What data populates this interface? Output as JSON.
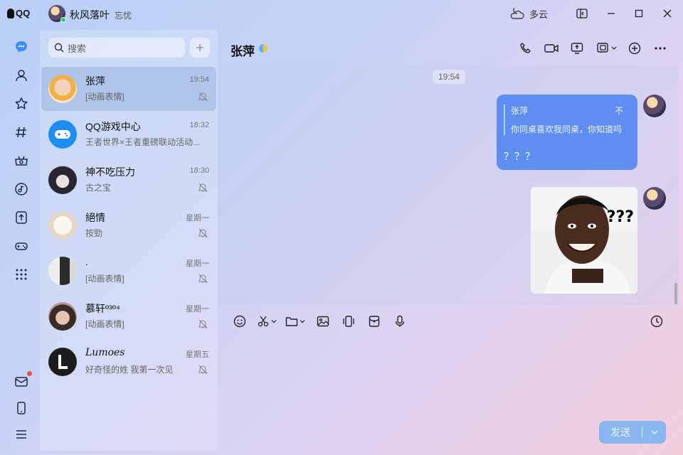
{
  "app": {
    "logo_text": "QQ",
    "accent": "#5f8df0"
  },
  "profile": {
    "name": "秋风落叶",
    "signature": "忘忧"
  },
  "weather": {
    "text": "多云",
    "icon": "cloud-moon-icon"
  },
  "nav": {
    "items": [
      "message-icon",
      "contacts-icon",
      "favorites-icon",
      "channel-icon",
      "games-icon",
      "music-icon",
      "upload-icon",
      "gamepad-icon",
      "more-apps-icon"
    ],
    "bottom": [
      "mail-icon",
      "phone-icon",
      "menu-icon"
    ]
  },
  "search": {
    "placeholder": "搜索"
  },
  "conversations": [
    {
      "name": "张萍",
      "preview": "[动画表情]",
      "time": "19:54",
      "muted": true,
      "selected": true
    },
    {
      "name": "QQ游戏中心",
      "preview": "王者世界×王者重磅联动活动...",
      "time": "18:32",
      "muted": false
    },
    {
      "name": "神不吃压力",
      "preview": "古之宝",
      "time": "18:30",
      "muted": true
    },
    {
      "name": "絕情",
      "preview": "按勁",
      "time": "星期一",
      "muted": true
    },
    {
      "name": ".",
      "preview": "[动画表情]",
      "time": "星期一",
      "muted": true
    },
    {
      "name": "慕轩º³º⁴",
      "preview": "[动画表情]",
      "time": "星期一",
      "muted": true
    },
    {
      "name": "Lumoes",
      "preview": "好奇怪的姓 我第一次见",
      "time": "星期五",
      "muted": true
    }
  ],
  "chat": {
    "title": "张萍",
    "time_divider": "19:54",
    "quote": {
      "name": "张萍",
      "mark": "不",
      "text": "你同桌喜欢我同桌，你知道吗"
    },
    "message": "？？？",
    "meme_text": "???",
    "send_label": "发送"
  }
}
